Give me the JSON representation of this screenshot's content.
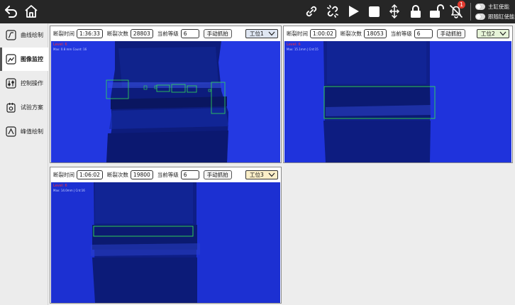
{
  "toolbar": {
    "left_icons": [
      "undo-icon",
      "home-icon"
    ],
    "right_icons": [
      "link-icon",
      "unlink-icon",
      "play-icon",
      "stop-icon",
      "move-axis-icon",
      "lock-icon",
      "unlock-icon",
      "bell-icon"
    ],
    "notification_count": "1",
    "toggles": [
      {
        "label": "主缸使能",
        "on": false
      },
      {
        "label": "跟随缸使能",
        "on": false
      }
    ]
  },
  "sidebar": {
    "items": [
      {
        "label": "曲线绘制",
        "icon": "curve-icon",
        "active": false
      },
      {
        "label": "图像监控",
        "icon": "image-monitor-icon",
        "active": true
      },
      {
        "label": "控制操作",
        "icon": "control-sliders-icon",
        "active": false
      },
      {
        "label": "试验方案",
        "icon": "test-plan-icon",
        "active": false
      },
      {
        "label": "峰值绘制",
        "icon": "peak-icon",
        "active": false
      }
    ]
  },
  "panels": [
    {
      "time_label": "断裂时间",
      "time": "1:36:33",
      "count_label": "断裂次数",
      "count": "28803",
      "level_label": "当前等级",
      "level": "6",
      "capture_label": "手动抓拍",
      "station": "工位1",
      "station_color": "#dfe6f2",
      "overlay_level": "Level: 6",
      "overlay_info": "Max: 0.8 mm   Count: 16"
    },
    {
      "time_label": "断裂时间",
      "time": "1:00:02",
      "count_label": "断裂次数",
      "count": "18053",
      "level_label": "当前等级",
      "level": "6",
      "capture_label": "手动抓拍",
      "station": "工位2",
      "station_color": "#e6f4d8",
      "overlay_level": "Level: 6",
      "overlay_info": "Max: 15.1mm  |  Cnt:15"
    },
    {
      "time_label": "断裂时间",
      "time": "1:06:02",
      "count_label": "断裂次数",
      "count": "19800",
      "level_label": "当前等级",
      "level": "6",
      "capture_label": "手动抓拍",
      "station": "工位3",
      "station_color": "#fbefc8",
      "overlay_level": "Level: 6",
      "overlay_info": "Max: 14.0mm  |  Cnt:16"
    }
  ],
  "colors": {
    "toolbar_bg": "#262626",
    "camera_blue": "#1a2fd8",
    "detection_box": "#33dd55",
    "badge_red": "#e03a2f"
  }
}
